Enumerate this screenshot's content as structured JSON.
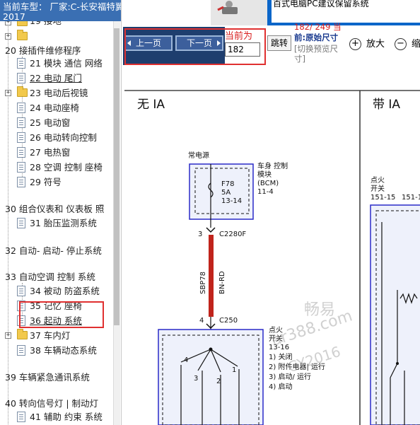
{
  "sidebar": {
    "header": "当前车型： 厂家:C-长安福特翼虎（KUGA）2016-2017",
    "items": [
      {
        "label": "19 接地"
      },
      {
        "label": ""
      },
      {
        "label": "20 接插件维修程序"
      },
      {
        "label": "21 模块 通信 网络"
      },
      {
        "label": "22 电动 尾门"
      },
      {
        "label": "23 电动后视镜"
      },
      {
        "label": "24 电动座椅"
      },
      {
        "label": "25 电动窗"
      },
      {
        "label": "26 电动转向控制"
      },
      {
        "label": "27 电热窗"
      },
      {
        "label": "28 空调 控制 座椅"
      },
      {
        "label": "29 符号"
      },
      {
        "label": "30 组合仪表和 仪表板 照"
      },
      {
        "label": "31 胎压监测系统"
      },
      {
        "label": "32 自动- 启动- 停止系统"
      },
      {
        "label": "33 自动空调 控制 系统"
      },
      {
        "label": "34 被动 防盗系统"
      },
      {
        "label": "35 记忆 座椅"
      },
      {
        "label": "36 起动 系统"
      },
      {
        "label": "37 车内灯"
      },
      {
        "label": "38 车辆动态系统"
      },
      {
        "label": "39 车辆紧急通讯系统"
      },
      {
        "label": "40 转向信号灯 | 制动灯"
      },
      {
        "label": "41 辅助 约束 系统"
      }
    ]
  },
  "banner": {
    "text": "百式电脑PC建议保留系统"
  },
  "toolbar": {
    "prev_label": "上一页",
    "next_label": "下一页",
    "page_label": "当前为",
    "page_value": "182",
    "jump_label": "跳转",
    "page_count": "182/ 249 当",
    "orig_size": "前:原始尺寸",
    "switch_hint": "[切换预览尺寸]",
    "zoom_in": "放大",
    "zoom_out": "缩"
  },
  "diagram": {
    "left_title": "无 IA",
    "right_title": "带 IA",
    "always_power": "常电源",
    "bcm_label_1": "车身 控制",
    "bcm_label_2": "模块",
    "bcm_label_3": "(BCM)",
    "bcm_label_4": "11-4",
    "fuse_1": "F78",
    "fuse_2": "5A",
    "fuse_3": "13-14",
    "pin3": "3",
    "conn1": "C2280F",
    "wire_code": "SBP78",
    "wire_color": "BN-RD",
    "pin4": "4",
    "conn2": "C250",
    "ign_1": "点火",
    "ign_2": "开关",
    "ign_3": "13-16",
    "ign_4": "1) 关闭",
    "ign_5": "2) 附件电器| 运行",
    "ign_6": "3) 启动/ 运行",
    "ign_7": "4) 启动",
    "sw_n1": "4",
    "sw_n2": "3",
    "sw_n3": "2",
    "sw_n4": "1",
    "r_ign_1": "点火",
    "r_ign_2": "开关",
    "r_ign_3": "151-15",
    "r_ign_4": "151-1"
  },
  "watermark": {
    "line1": "畅易",
    "line2": "ar388.com",
    "line3": "CY2016"
  },
  "colors": {
    "accent": "#3a6fb3",
    "highlight": "#e03030",
    "wire": "#c0241c",
    "module_border": "#2a2ac8"
  }
}
